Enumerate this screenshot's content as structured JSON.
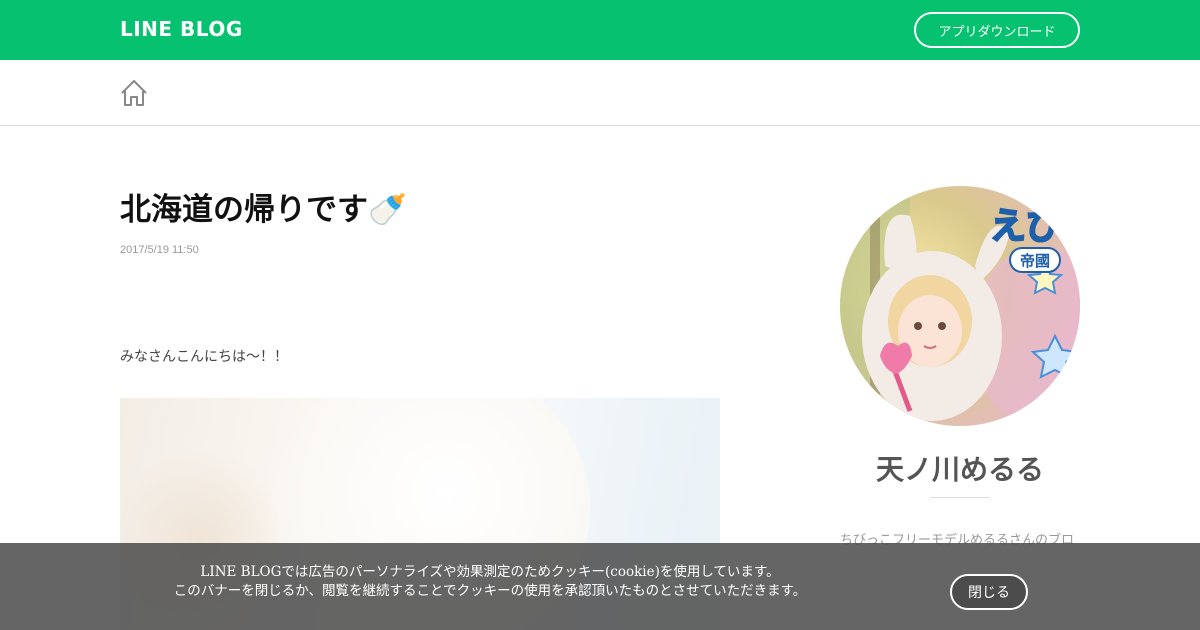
{
  "header": {
    "logo": "LINE BLOG",
    "app_download_label": "アプリダウンロード"
  },
  "nav": {
    "home_icon": "home-icon"
  },
  "post": {
    "title": "北海道の帰りです🍼",
    "date": "2017/5/19 11:50",
    "body_first_line": "みなさんこんにちは～！！"
  },
  "sidebar": {
    "profile_name": "天ノ川めるる",
    "profile_description": "ちびっこフリーモデルめるるさんのブロ",
    "avatar_badge_text": "えびちゃ",
    "avatar_badge_sub": "帝國"
  },
  "cookie_banner": {
    "line1": "LINE BLOGでは広告のパーソナライズや効果測定のためクッキー(cookie)を使用しています。",
    "line2": "このバナーを閉じるか、閲覧を継続することでクッキーの使用を承認頂いたものとさせていただきます。",
    "close_label": "閉じる"
  },
  "colors": {
    "brand": "#06c270",
    "banner": "#505050"
  }
}
